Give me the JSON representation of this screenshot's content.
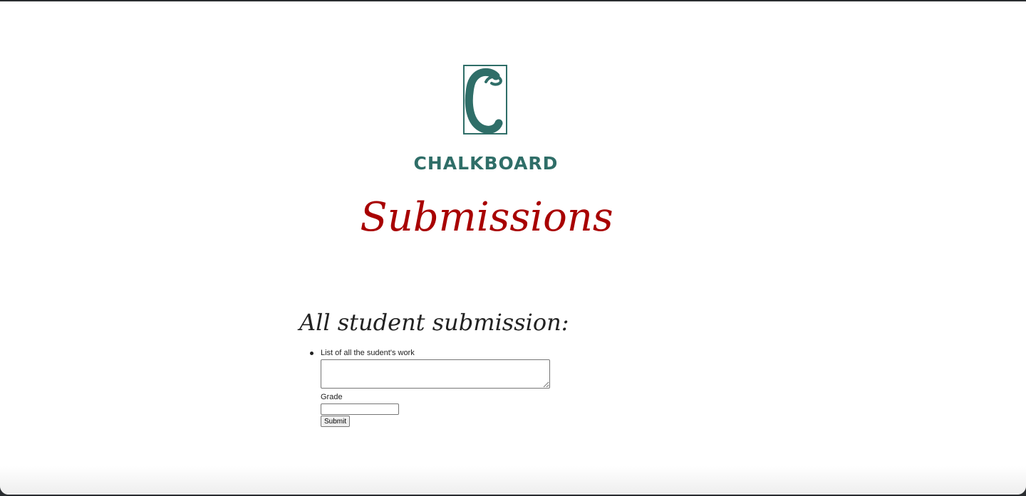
{
  "logo": {
    "letter": "C",
    "brand_name": "CHALKBOARD",
    "color": "#2f6e68"
  },
  "page": {
    "title": "Submissions",
    "title_color": "#a80000"
  },
  "section": {
    "heading": "All student submission:"
  },
  "submissions": [
    {
      "label": "List of all the sudent's work",
      "work_value": "",
      "grade_label": "Grade",
      "grade_value": "",
      "submit_label": "Submit"
    }
  ]
}
